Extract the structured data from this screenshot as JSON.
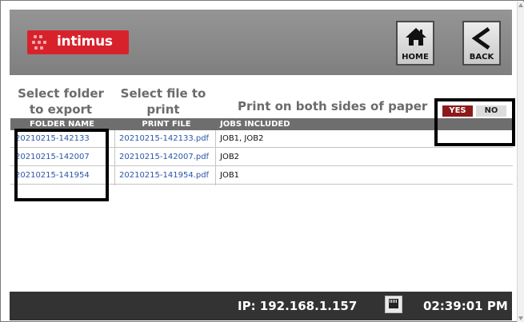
{
  "header": {
    "logo_text": "intimus",
    "home_label": "HOME",
    "back_label": "BACK"
  },
  "headings": {
    "folder": "Select folder to export",
    "file": "Select file to print",
    "duplex": "Print on both sides of paper"
  },
  "duplex": {
    "yes_label": "YES",
    "no_label": "NO"
  },
  "table": {
    "columns": [
      "FOLDER NAME",
      "PRINT FILE",
      "JOBS INCLUDED"
    ],
    "rows": [
      {
        "folder": "20210215-142133",
        "file": "20210215-142133.pdf",
        "jobs": "JOB1, JOB2"
      },
      {
        "folder": "20210215-142007",
        "file": "20210215-142007.pdf",
        "jobs": "JOB2"
      },
      {
        "folder": "20210215-141954",
        "file": "20210215-141954.pdf",
        "jobs": "JOB1"
      }
    ]
  },
  "footer": {
    "ip": "IP: 192.168.1.157",
    "time": "02:39:01 PM",
    "network_icon": "ethernet-icon"
  },
  "colors": {
    "header_bg": "#888888",
    "logo_red": "#d8222b",
    "table_header": "#6e6e6e",
    "link_blue": "#2b55a8",
    "footer_bg": "#333333",
    "yes_red": "#8c1a1a"
  }
}
